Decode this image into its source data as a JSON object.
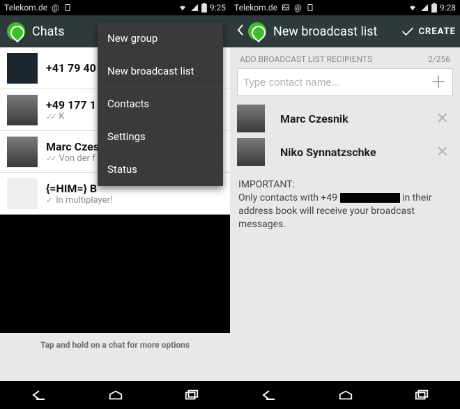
{
  "left": {
    "status": {
      "carrier": "Telekom.de",
      "time": "9:25"
    },
    "actionbar": {
      "title": "Chats"
    },
    "chats": [
      {
        "name": "+41 79 40",
        "sub": ""
      },
      {
        "name": "+49 177 1",
        "sub": "K"
      },
      {
        "name": "Marc Czes",
        "sub": "Von der f"
      },
      {
        "name": "{=HIM=} B",
        "sub": "In multiplayer!"
      }
    ],
    "menu": [
      "New group",
      "New broadcast list",
      "Contacts",
      "Settings",
      "Status"
    ],
    "hint": "Tap and hold on a chat for more options"
  },
  "right": {
    "status": {
      "carrier": "Telekom.de",
      "time": "9:28"
    },
    "actionbar": {
      "title": "New broadcast list",
      "create": "CREATE"
    },
    "bc": {
      "header_label": "ADD BROADCAST LIST RECIPIENTS",
      "count": "2/256",
      "placeholder": "Type contact name...",
      "recipients": [
        {
          "name": "Marc Czesnik"
        },
        {
          "name": "Niko Synnatzschke"
        }
      ],
      "important_label": "IMPORTANT:",
      "important_prefix": "Only contacts with +49 ",
      "important_suffix": " in their address book will receive your broadcast messages."
    }
  }
}
